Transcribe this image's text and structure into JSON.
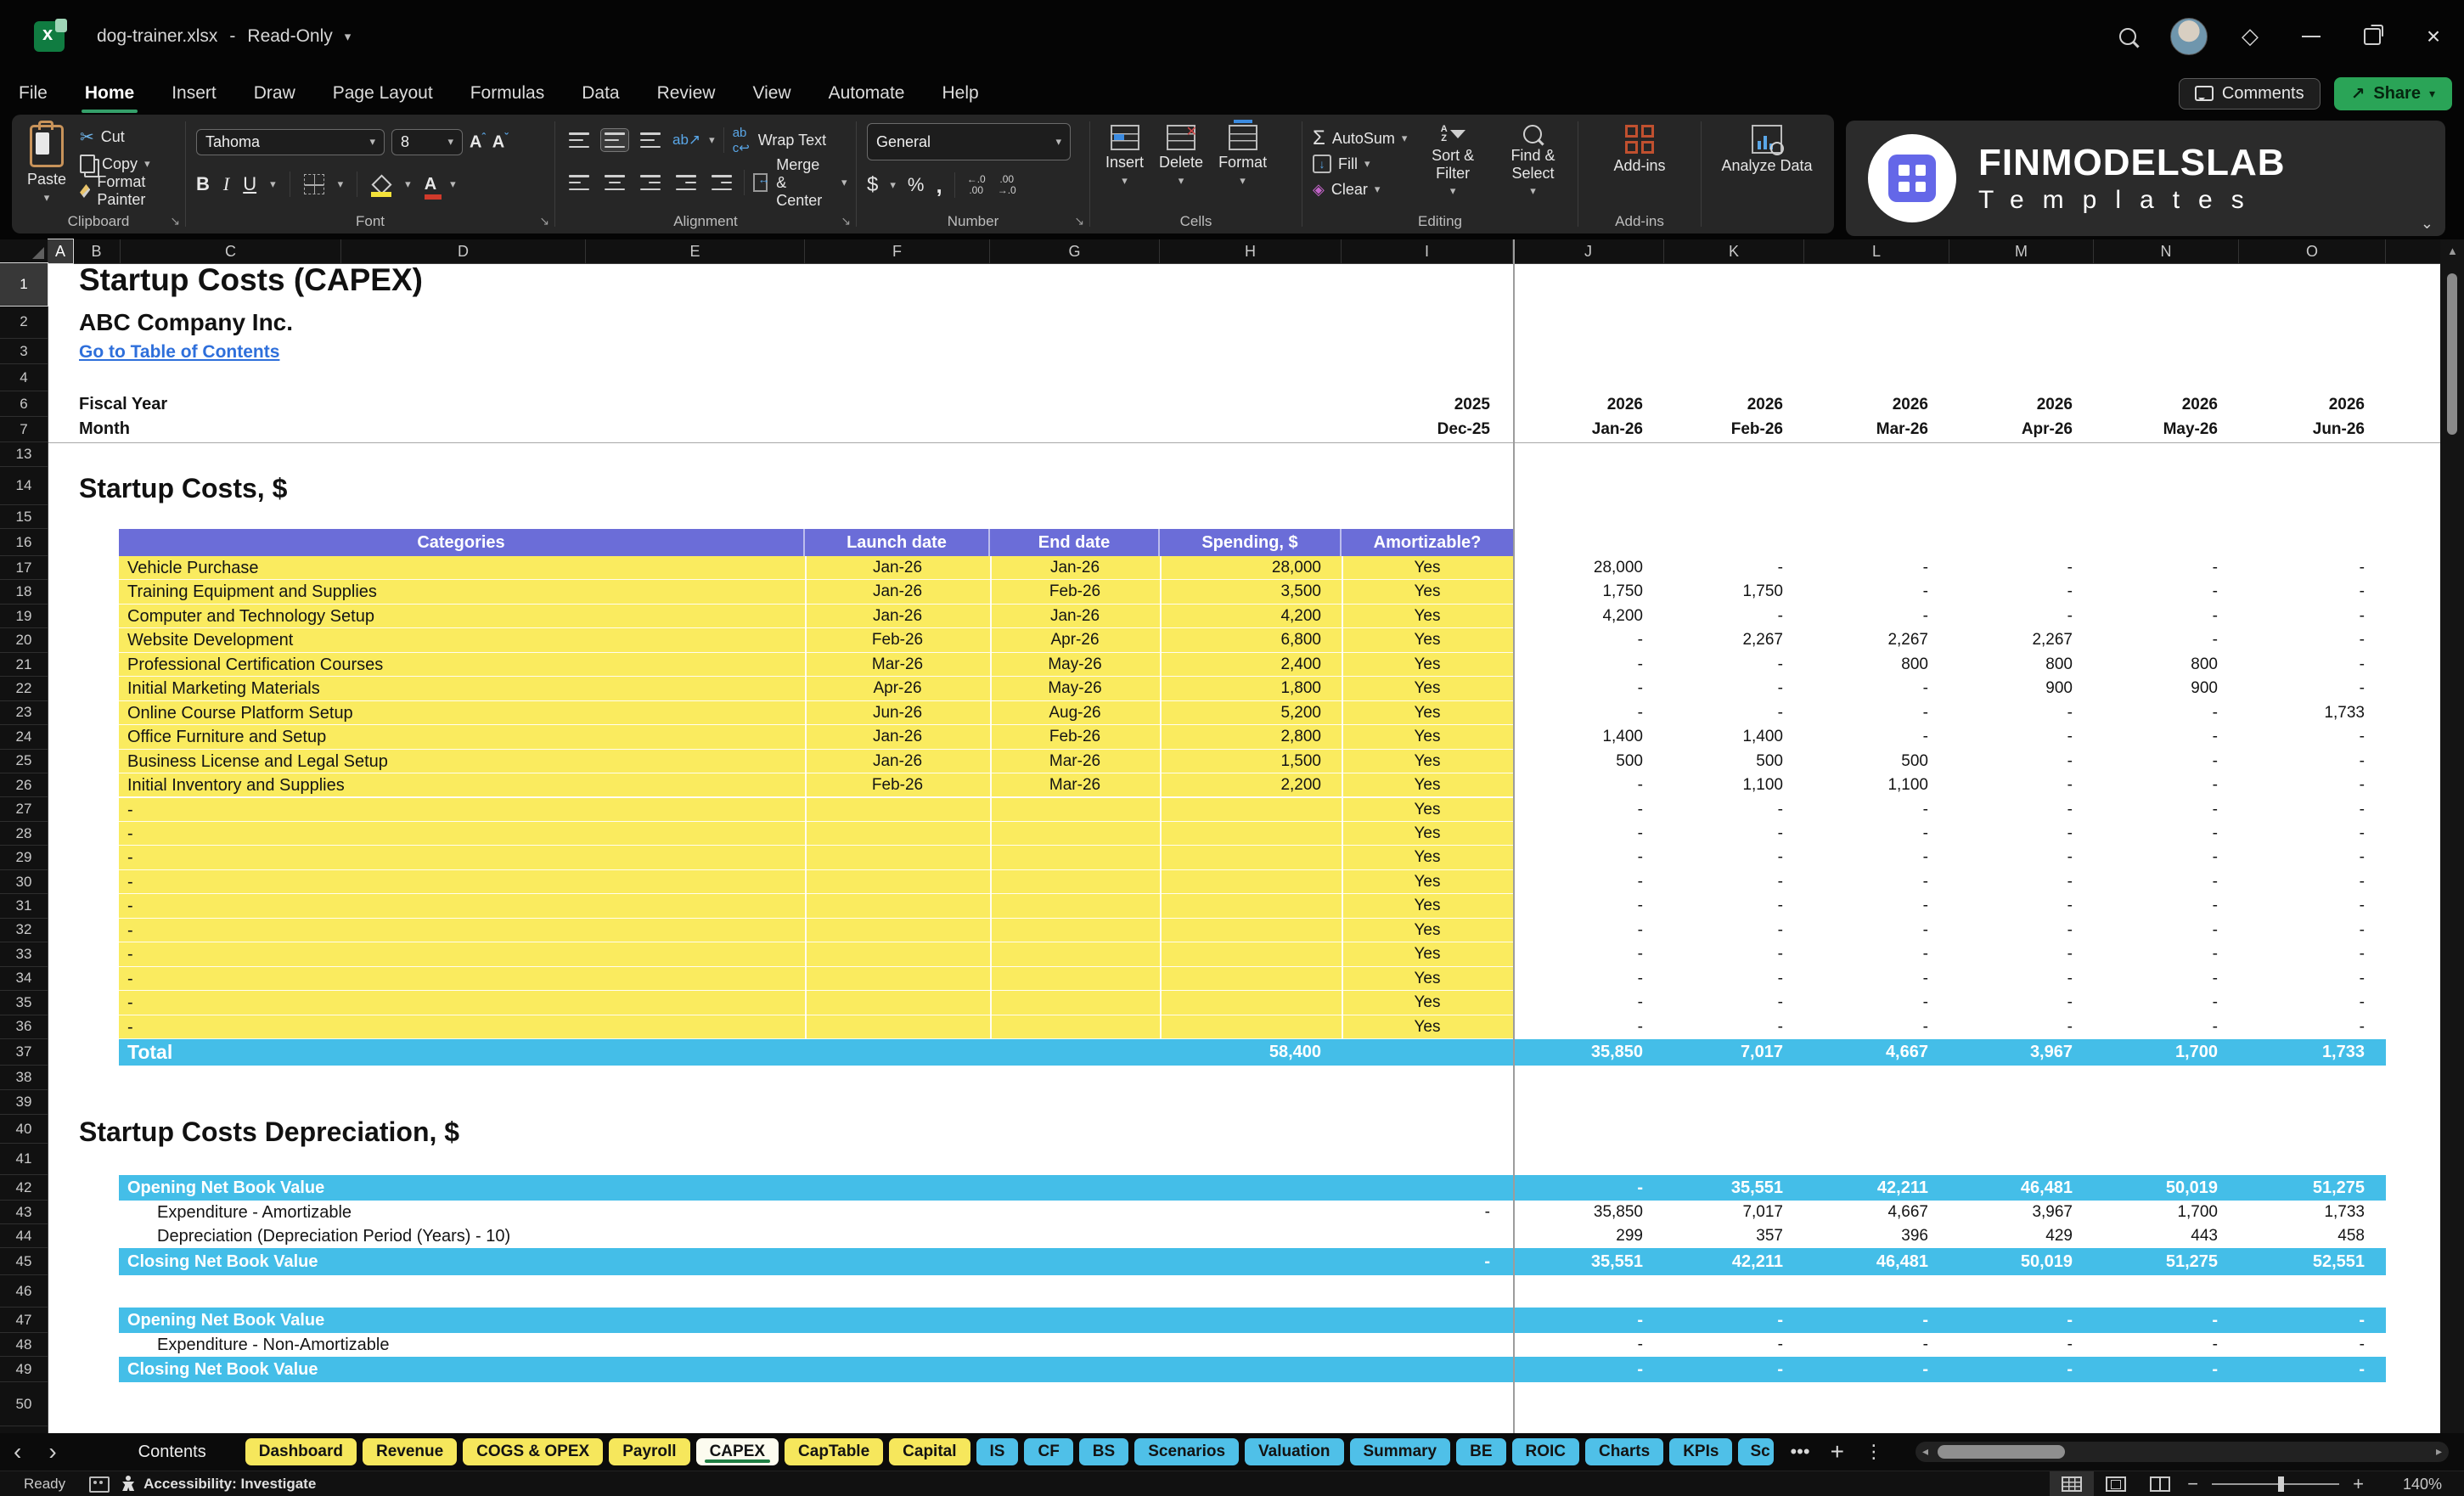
{
  "titlebar": {
    "filename": "dog-trainer.xlsx",
    "separator": "-",
    "mode": "Read-Only"
  },
  "menu": {
    "items": [
      "File",
      "Home",
      "Insert",
      "Draw",
      "Page Layout",
      "Formulas",
      "Data",
      "Review",
      "View",
      "Automate",
      "Help"
    ],
    "active": "Home",
    "comments": "Comments",
    "share": "Share"
  },
  "ribbon": {
    "clipboard": {
      "paste": "Paste",
      "cut": "Cut",
      "copy": "Copy",
      "format_painter": "Format Painter",
      "label": "Clipboard"
    },
    "font": {
      "family": "Tahoma",
      "size": "8",
      "bold": "B",
      "italic": "I",
      "underline": "U",
      "label": "Font"
    },
    "alignment": {
      "wrap": "Wrap Text",
      "merge": "Merge & Center",
      "label": "Alignment"
    },
    "number": {
      "format": "General",
      "label": "Number"
    },
    "cells": {
      "insert": "Insert",
      "delete": "Delete",
      "format": "Format",
      "label": "Cells"
    },
    "editing": {
      "autosum": "AutoSum",
      "fill": "Fill",
      "clear": "Clear",
      "sort": "Sort & Filter",
      "find": "Find & Select",
      "label": "Editing"
    },
    "addins": {
      "addins": "Add-ins",
      "label": "Add-ins",
      "analyze": "Analyze Data"
    }
  },
  "brand": {
    "name": "FINMODELSLAB",
    "sub": "Templates"
  },
  "sheet": {
    "columns": [
      "A",
      "B",
      "C",
      "D",
      "E",
      "F",
      "G",
      "H",
      "I",
      "J",
      "K",
      "L",
      "M",
      "N",
      "O"
    ],
    "row_numbers": [
      "1",
      "2",
      "3",
      "4",
      "6",
      "7",
      "13",
      "14",
      "15",
      "16",
      "17",
      "18",
      "19",
      "20",
      "21",
      "22",
      "23",
      "24",
      "25",
      "26",
      "27",
      "28",
      "29",
      "30",
      "31",
      "32",
      "33",
      "34",
      "35",
      "36",
      "37",
      "38",
      "39",
      "40",
      "41",
      "42",
      "43",
      "44",
      "45",
      "46",
      "47",
      "48",
      "49",
      "50"
    ],
    "title": "Startup Costs (CAPEX)",
    "company": "ABC Company Inc.",
    "link": "Go to Table of Contents",
    "fiscal_label": "Fiscal Year",
    "month_label": "Month",
    "fiscal_years": [
      "2025",
      "2026",
      "2026",
      "2026",
      "2026",
      "2026",
      "2026"
    ],
    "months": [
      "Dec-25",
      "Jan-26",
      "Feb-26",
      "Mar-26",
      "Apr-26",
      "May-26",
      "Jun-26"
    ],
    "section1_title": "Startup Costs, $",
    "table": {
      "headers": [
        "Categories",
        "Launch date",
        "End date",
        "Spending, $",
        "Amortizable?"
      ],
      "rows": [
        {
          "category": "Vehicle Purchase",
          "launch": "Jan-26",
          "end": "Jan-26",
          "spending": "28,000",
          "amortizable": "Yes",
          "monthly": [
            "28,000",
            "-",
            "-",
            "-",
            "-",
            "-"
          ]
        },
        {
          "category": "Training Equipment and Supplies",
          "launch": "Jan-26",
          "end": "Feb-26",
          "spending": "3,500",
          "amortizable": "Yes",
          "monthly": [
            "1,750",
            "1,750",
            "-",
            "-",
            "-",
            "-"
          ]
        },
        {
          "category": "Computer and Technology Setup",
          "launch": "Jan-26",
          "end": "Jan-26",
          "spending": "4,200",
          "amortizable": "Yes",
          "monthly": [
            "4,200",
            "-",
            "-",
            "-",
            "-",
            "-"
          ]
        },
        {
          "category": "Website Development",
          "launch": "Feb-26",
          "end": "Apr-26",
          "spending": "6,800",
          "amortizable": "Yes",
          "monthly": [
            "-",
            "2,267",
            "2,267",
            "2,267",
            "-",
            "-"
          ]
        },
        {
          "category": "Professional Certification Courses",
          "launch": "Mar-26",
          "end": "May-26",
          "spending": "2,400",
          "amortizable": "Yes",
          "monthly": [
            "-",
            "-",
            "800",
            "800",
            "800",
            "-"
          ]
        },
        {
          "category": "Initial Marketing Materials",
          "launch": "Apr-26",
          "end": "May-26",
          "spending": "1,800",
          "amortizable": "Yes",
          "monthly": [
            "-",
            "-",
            "-",
            "900",
            "900",
            "-"
          ]
        },
        {
          "category": "Online Course Platform Setup",
          "launch": "Jun-26",
          "end": "Aug-26",
          "spending": "5,200",
          "amortizable": "Yes",
          "monthly": [
            "-",
            "-",
            "-",
            "-",
            "-",
            "1,733"
          ]
        },
        {
          "category": "Office Furniture and Setup",
          "launch": "Jan-26",
          "end": "Feb-26",
          "spending": "2,800",
          "amortizable": "Yes",
          "monthly": [
            "1,400",
            "1,400",
            "-",
            "-",
            "-",
            "-"
          ]
        },
        {
          "category": "Business License and Legal Setup",
          "launch": "Jan-26",
          "end": "Mar-26",
          "spending": "1,500",
          "amortizable": "Yes",
          "monthly": [
            "500",
            "500",
            "500",
            "-",
            "-",
            "-"
          ]
        },
        {
          "category": "Initial Inventory and Supplies",
          "launch": "Feb-26",
          "end": "Mar-26",
          "spending": "2,200",
          "amortizable": "Yes",
          "monthly": [
            "-",
            "1,100",
            "1,100",
            "-",
            "-",
            "-"
          ]
        }
      ],
      "empty_row": {
        "category": "-",
        "amortizable": "Yes",
        "monthly": [
          "-",
          "-",
          "-",
          "-",
          "-",
          "-"
        ],
        "count": 10
      },
      "total": {
        "label": "Total",
        "spending": "58,400",
        "monthly": [
          "35,850",
          "7,017",
          "4,667",
          "3,967",
          "1,700",
          "1,733"
        ]
      }
    },
    "section2_title": "Startup Costs Depreciation, $",
    "depreciation": {
      "group1": [
        {
          "label": "Opening Net Book Value",
          "style": "blue",
          "values": [
            "",
            "-",
            "35,551",
            "42,211",
            "46,481",
            "50,019",
            "51,275"
          ]
        },
        {
          "label": "Expenditure - Amortizable",
          "style": "plain",
          "values": [
            "-",
            "35,850",
            "7,017",
            "4,667",
            "3,967",
            "1,700",
            "1,733"
          ]
        },
        {
          "label": "Depreciation (Depreciation Period (Years) - 10)",
          "style": "plain",
          "values": [
            "",
            "299",
            "357",
            "396",
            "429",
            "443",
            "458"
          ]
        },
        {
          "label": "Closing Net Book Value",
          "style": "blue",
          "values": [
            "-",
            "35,551",
            "42,211",
            "46,481",
            "50,019",
            "51,275",
            "52,551"
          ]
        }
      ],
      "group2": [
        {
          "label": "Opening Net Book Value",
          "style": "blue",
          "values": [
            "",
            "-",
            "-",
            "-",
            "-",
            "-",
            "-"
          ]
        },
        {
          "label": "Expenditure - Non-Amortizable",
          "style": "plain",
          "values": [
            "",
            "-",
            "-",
            "-",
            "-",
            "-",
            "-"
          ]
        },
        {
          "label": "Closing Net Book Value",
          "style": "blue",
          "values": [
            "",
            "-",
            "-",
            "-",
            "-",
            "-",
            "-"
          ]
        }
      ]
    }
  },
  "tabs": {
    "nav_left": "‹",
    "nav_right": "›",
    "items": [
      {
        "label": "Contents",
        "style": "plain"
      },
      {
        "label": "Dashboard",
        "style": "yellow"
      },
      {
        "label": "Revenue",
        "style": "yellow"
      },
      {
        "label": "COGS & OPEX",
        "style": "yellow"
      },
      {
        "label": "Payroll",
        "style": "yellow"
      },
      {
        "label": "CAPEX",
        "style": "active"
      },
      {
        "label": "CapTable",
        "style": "yellow"
      },
      {
        "label": "Capital",
        "style": "yellow"
      },
      {
        "label": "IS",
        "style": "blue"
      },
      {
        "label": "CF",
        "style": "blue"
      },
      {
        "label": "BS",
        "style": "blue"
      },
      {
        "label": "Scenarios",
        "style": "blue"
      },
      {
        "label": "Valuation",
        "style": "blue"
      },
      {
        "label": "Summary",
        "style": "blue"
      },
      {
        "label": "BE",
        "style": "blue"
      },
      {
        "label": "ROIC",
        "style": "blue"
      },
      {
        "label": "Charts",
        "style": "blue"
      },
      {
        "label": "KPIs",
        "style": "blue"
      },
      {
        "label": "Sc",
        "style": "blue-cut"
      }
    ],
    "more": "•••",
    "add": "+",
    "menu": "⋮"
  },
  "status": {
    "ready": "Ready",
    "accessibility": "Accessibility: Investigate",
    "zoom": "140%"
  },
  "colors": {
    "header_purple": "#6B6DD8",
    "row_yellow": "#FAEB5F",
    "total_blue": "#44BEE8",
    "tab_yellow": "#F6E75C",
    "tab_blue": "#4FC0E8",
    "accent_green": "#2AA457",
    "link_blue": "#2E6FDB"
  }
}
